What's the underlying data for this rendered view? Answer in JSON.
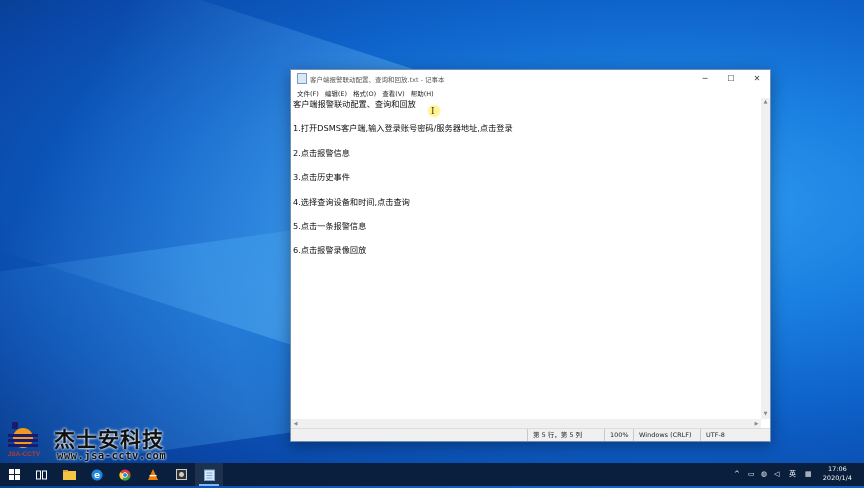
{
  "window": {
    "title": "客户端报警联动配置、查询和回放.txt - 记事本",
    "controls": {
      "minimize": "─",
      "maximize": "☐",
      "close": "✕"
    }
  },
  "menu": [
    "文件(F)",
    "编辑(E)",
    "格式(O)",
    "查看(V)",
    "帮助(H)"
  ],
  "document": {
    "lines": [
      "客户端报警联动配置、查询和回放",
      "",
      "1.打开DSMS客户端,输入登录账号密码/服务器地址,点击登录",
      "",
      "2.点击报警信息",
      "",
      "3.点击历史事件",
      "",
      "4.选择查询设备和时间,点击查询",
      "",
      "5.点击一条报警信息",
      "",
      "6.点击报警录像回放"
    ]
  },
  "status": {
    "position": "第 5 行，第 5 列",
    "zoom": "100%",
    "line_ending": "Windows (CRLF)",
    "encoding": "UTF-8"
  },
  "watermark": {
    "logo_text": "JSA-CCTV",
    "company": "杰士安科技",
    "url": "www.jsa-cctv.com"
  },
  "taskbar": {
    "icons": [
      "windows-start-icon",
      "task-view-icon",
      "file-explorer-icon",
      "edge-icon",
      "chrome-icon",
      "vlc-icon",
      "app-icon",
      "notepad-icon"
    ],
    "tray": {
      "ime": "英"
    },
    "clock": {
      "time": "17:06",
      "date": "2020/1/4"
    }
  },
  "colors": {
    "desktop": "#0d5fc6",
    "taskbar": "#0a1f3d",
    "highlight": "#ffeb50"
  }
}
